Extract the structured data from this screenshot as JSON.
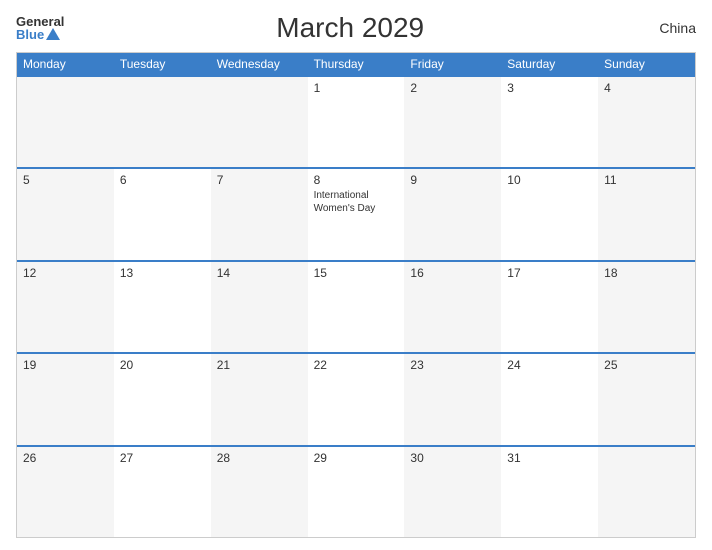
{
  "header": {
    "logo_general": "General",
    "logo_blue": "Blue",
    "title": "March 2029",
    "country": "China"
  },
  "days": {
    "headers": [
      "Monday",
      "Tuesday",
      "Wednesday",
      "Thursday",
      "Friday",
      "Saturday",
      "Sunday"
    ]
  },
  "weeks": [
    [
      {
        "num": "",
        "empty": true
      },
      {
        "num": "",
        "empty": true
      },
      {
        "num": "",
        "empty": true
      },
      {
        "num": "1",
        "event": ""
      },
      {
        "num": "2",
        "event": ""
      },
      {
        "num": "3",
        "event": ""
      },
      {
        "num": "4",
        "event": ""
      }
    ],
    [
      {
        "num": "5",
        "event": ""
      },
      {
        "num": "6",
        "event": ""
      },
      {
        "num": "7",
        "event": ""
      },
      {
        "num": "8",
        "event": "International Women's Day"
      },
      {
        "num": "9",
        "event": ""
      },
      {
        "num": "10",
        "event": ""
      },
      {
        "num": "11",
        "event": ""
      }
    ],
    [
      {
        "num": "12",
        "event": ""
      },
      {
        "num": "13",
        "event": ""
      },
      {
        "num": "14",
        "event": ""
      },
      {
        "num": "15",
        "event": ""
      },
      {
        "num": "16",
        "event": ""
      },
      {
        "num": "17",
        "event": ""
      },
      {
        "num": "18",
        "event": ""
      }
    ],
    [
      {
        "num": "19",
        "event": ""
      },
      {
        "num": "20",
        "event": ""
      },
      {
        "num": "21",
        "event": ""
      },
      {
        "num": "22",
        "event": ""
      },
      {
        "num": "23",
        "event": ""
      },
      {
        "num": "24",
        "event": ""
      },
      {
        "num": "25",
        "event": ""
      }
    ],
    [
      {
        "num": "26",
        "event": ""
      },
      {
        "num": "27",
        "event": ""
      },
      {
        "num": "28",
        "event": ""
      },
      {
        "num": "29",
        "event": ""
      },
      {
        "num": "30",
        "event": ""
      },
      {
        "num": "31",
        "event": ""
      },
      {
        "num": "",
        "empty": true
      }
    ]
  ]
}
